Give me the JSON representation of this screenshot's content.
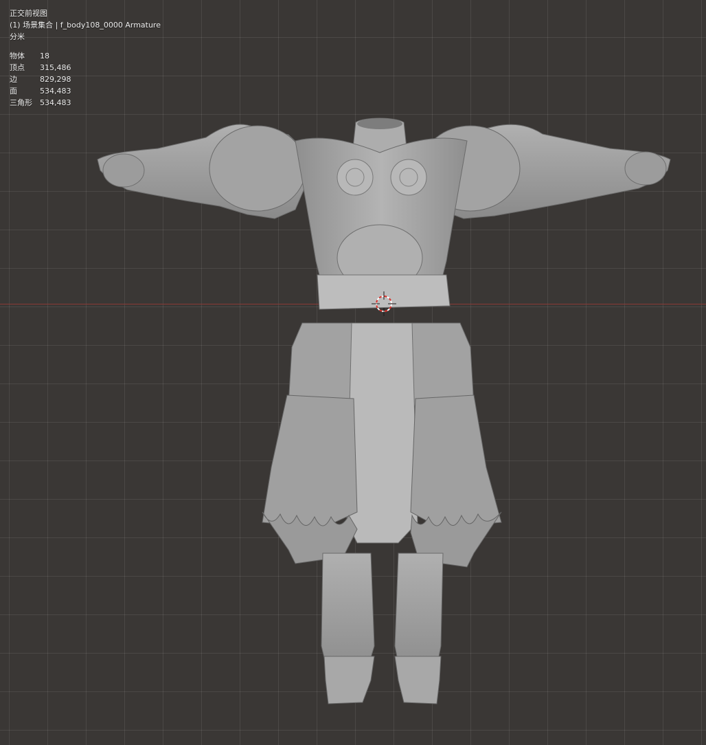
{
  "viewport": {
    "view_name": "正交前视图",
    "collection_line": "(1) 场景集合 | f_body108_0000 Armature",
    "unit": "分米",
    "stats": [
      {
        "label": "物体",
        "value": "18"
      },
      {
        "label": "顶点",
        "value": "315,486"
      },
      {
        "label": "边",
        "value": "829,298"
      },
      {
        "label": "面",
        "value": "534,483"
      },
      {
        "label": "三角形",
        "value": "534,483"
      }
    ]
  },
  "colors": {
    "background": "#3a3735",
    "grid": "#4a4745",
    "x_axis": "#8a3a36",
    "model": "#a7a7a7",
    "cursor_red": "#d8322c"
  },
  "icons": [
    "3d-cursor-icon"
  ]
}
